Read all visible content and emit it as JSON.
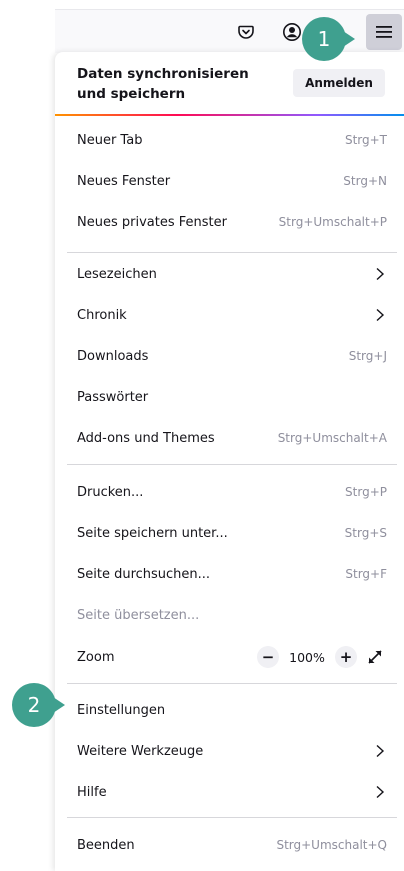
{
  "toolbar": {
    "pocket_icon": "pocket-icon",
    "account_icon": "account-icon",
    "menu_icon": "hamburger-menu-icon"
  },
  "sync": {
    "text": "Daten synchronisieren und speichern",
    "button_label": "Anmelden"
  },
  "menu": {
    "group1": [
      {
        "label": "Neuer Tab",
        "shortcut": "Strg+T"
      },
      {
        "label": "Neues Fenster",
        "shortcut": "Strg+N"
      },
      {
        "label": "Neues privates Fenster",
        "shortcut": "Strg+Umschalt+P"
      }
    ],
    "group2": [
      {
        "label": "Lesezeichen",
        "shortcut": ""
      },
      {
        "label": "Chronik",
        "shortcut": ""
      },
      {
        "label": "Downloads",
        "shortcut": "Strg+J"
      },
      {
        "label": "Passwörter",
        "shortcut": ""
      },
      {
        "label": "Add-ons und Themes",
        "shortcut": "Strg+Umschalt+A"
      }
    ],
    "group3": [
      {
        "label": "Drucken...",
        "shortcut": "Strg+P"
      },
      {
        "label": "Seite speichern unter...",
        "shortcut": "Strg+S"
      },
      {
        "label": "Seite durchsuchen...",
        "shortcut": "Strg+F"
      },
      {
        "label": "Seite übersetzen...",
        "shortcut": ""
      }
    ],
    "zoom": {
      "label": "Zoom",
      "minus": "−",
      "value": "100%",
      "plus": "+"
    },
    "group4": [
      {
        "label": "Einstellungen",
        "shortcut": ""
      },
      {
        "label": "Weitere Werkzeuge",
        "shortcut": ""
      },
      {
        "label": "Hilfe",
        "shortcut": ""
      }
    ],
    "group5": [
      {
        "label": "Beenden",
        "shortcut": "Strg+Umschalt+Q"
      }
    ]
  },
  "callouts": {
    "one": "1",
    "two": "2"
  },
  "colors": {
    "callout": "#3fa08f",
    "menu_button_bg": "#cfcfd8"
  }
}
